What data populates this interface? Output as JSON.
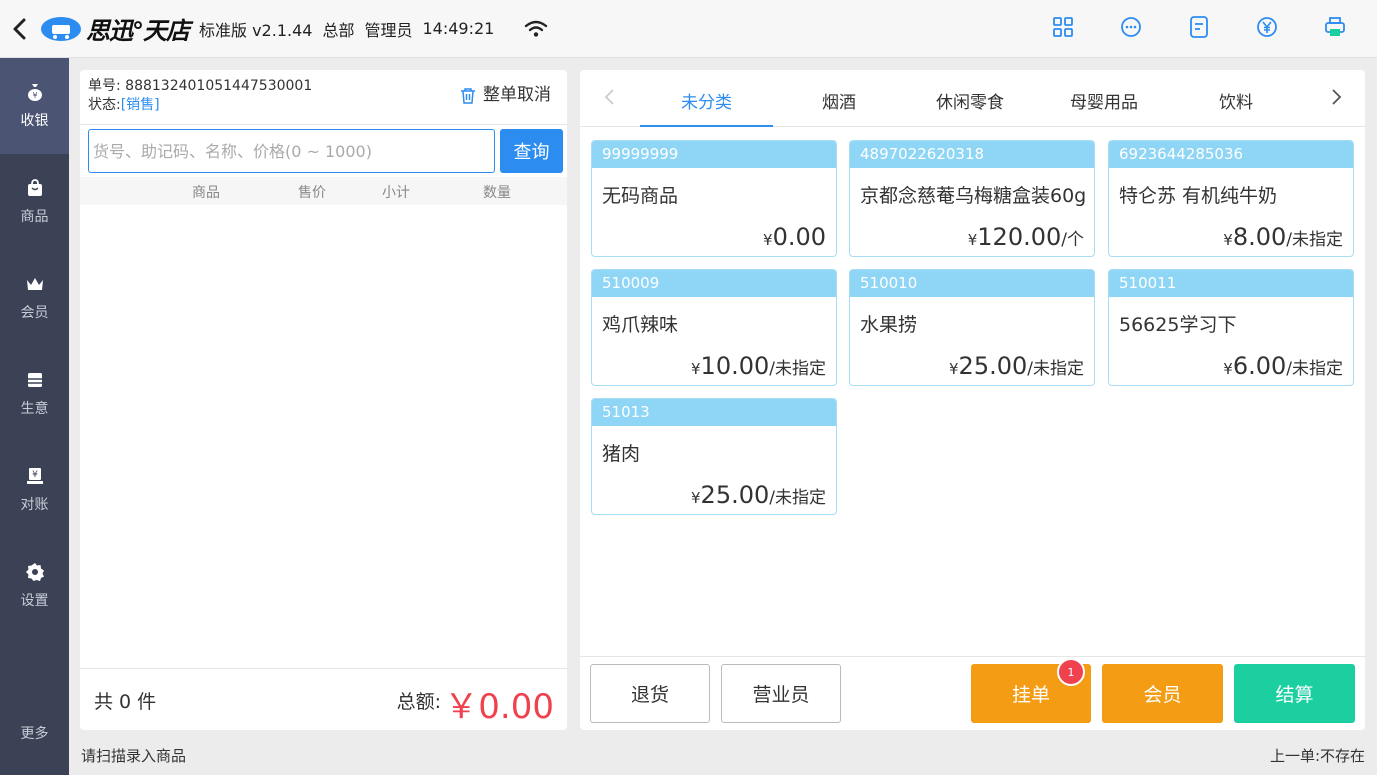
{
  "header": {
    "brand": "思迅°天店",
    "edition": "标准版 v2.1.44",
    "store": "总部",
    "user": "管理员",
    "time": "14:49:21"
  },
  "sidebar": {
    "items": [
      {
        "label": "收银",
        "icon": "money-bag-icon",
        "active": true
      },
      {
        "label": "商品",
        "icon": "shopping-bag-icon"
      },
      {
        "label": "会员",
        "icon": "crown-icon"
      },
      {
        "label": "生意",
        "icon": "register-icon"
      },
      {
        "label": "对账",
        "icon": "reconcile-icon"
      },
      {
        "label": "设置",
        "icon": "gear-icon"
      }
    ],
    "more": "更多"
  },
  "order": {
    "number_label": "单号:",
    "number": "888132401051447530001",
    "status_label": "状态:",
    "status": "[销售]",
    "cancel_label": "整单取消"
  },
  "search": {
    "placeholder": "货号、助记码、名称、价格(0 ~ 1000)",
    "button": "查询"
  },
  "cart_columns": [
    "商品",
    "售价",
    "小计",
    "数量"
  ],
  "cart_footer": {
    "count_text": "共 0 件",
    "total_label": "总额:",
    "total_value": "￥0.00"
  },
  "categories": {
    "tabs": [
      "未分类",
      "烟酒",
      "休闲零食",
      "母婴用品",
      "饮料"
    ],
    "active": "未分类"
  },
  "products": [
    {
      "code": "99999999",
      "name": "无码商品",
      "yen": "¥",
      "price": "0.00",
      "unit": ""
    },
    {
      "code": "4897022620318",
      "name": "京都念慈菴乌梅糖盒装60g",
      "yen": "¥",
      "price": "120.00",
      "unit": "/个"
    },
    {
      "code": "6923644285036",
      "name": "特仑苏 有机纯牛奶",
      "yen": "¥",
      "price": "8.00",
      "unit": "/未指定"
    },
    {
      "code": "510009",
      "name": "鸡爪辣味",
      "yen": "¥",
      "price": "10.00",
      "unit": "/未指定"
    },
    {
      "code": "510010",
      "name": "水果捞",
      "yen": "¥",
      "price": "25.00",
      "unit": "/未指定"
    },
    {
      "code": "510011",
      "name": "56625学习下",
      "yen": "¥",
      "price": "6.00",
      "unit": "/未指定"
    },
    {
      "code": "51013",
      "name": "猪肉",
      "yen": "¥",
      "price": "25.00",
      "unit": "/未指定"
    }
  ],
  "actions": {
    "return": "退货",
    "clerk": "营业员",
    "hold": "挂单",
    "hold_badge": "1",
    "member": "会员",
    "checkout": "结算"
  },
  "statusbar": {
    "left": "请扫描录入商品",
    "right": "上一单:不存在"
  },
  "colors": {
    "accent": "#2d8cf0",
    "sidebar": "#3b4256",
    "orange": "#f39c14",
    "green": "#1ccfa0",
    "price_red": "#f0414f"
  }
}
